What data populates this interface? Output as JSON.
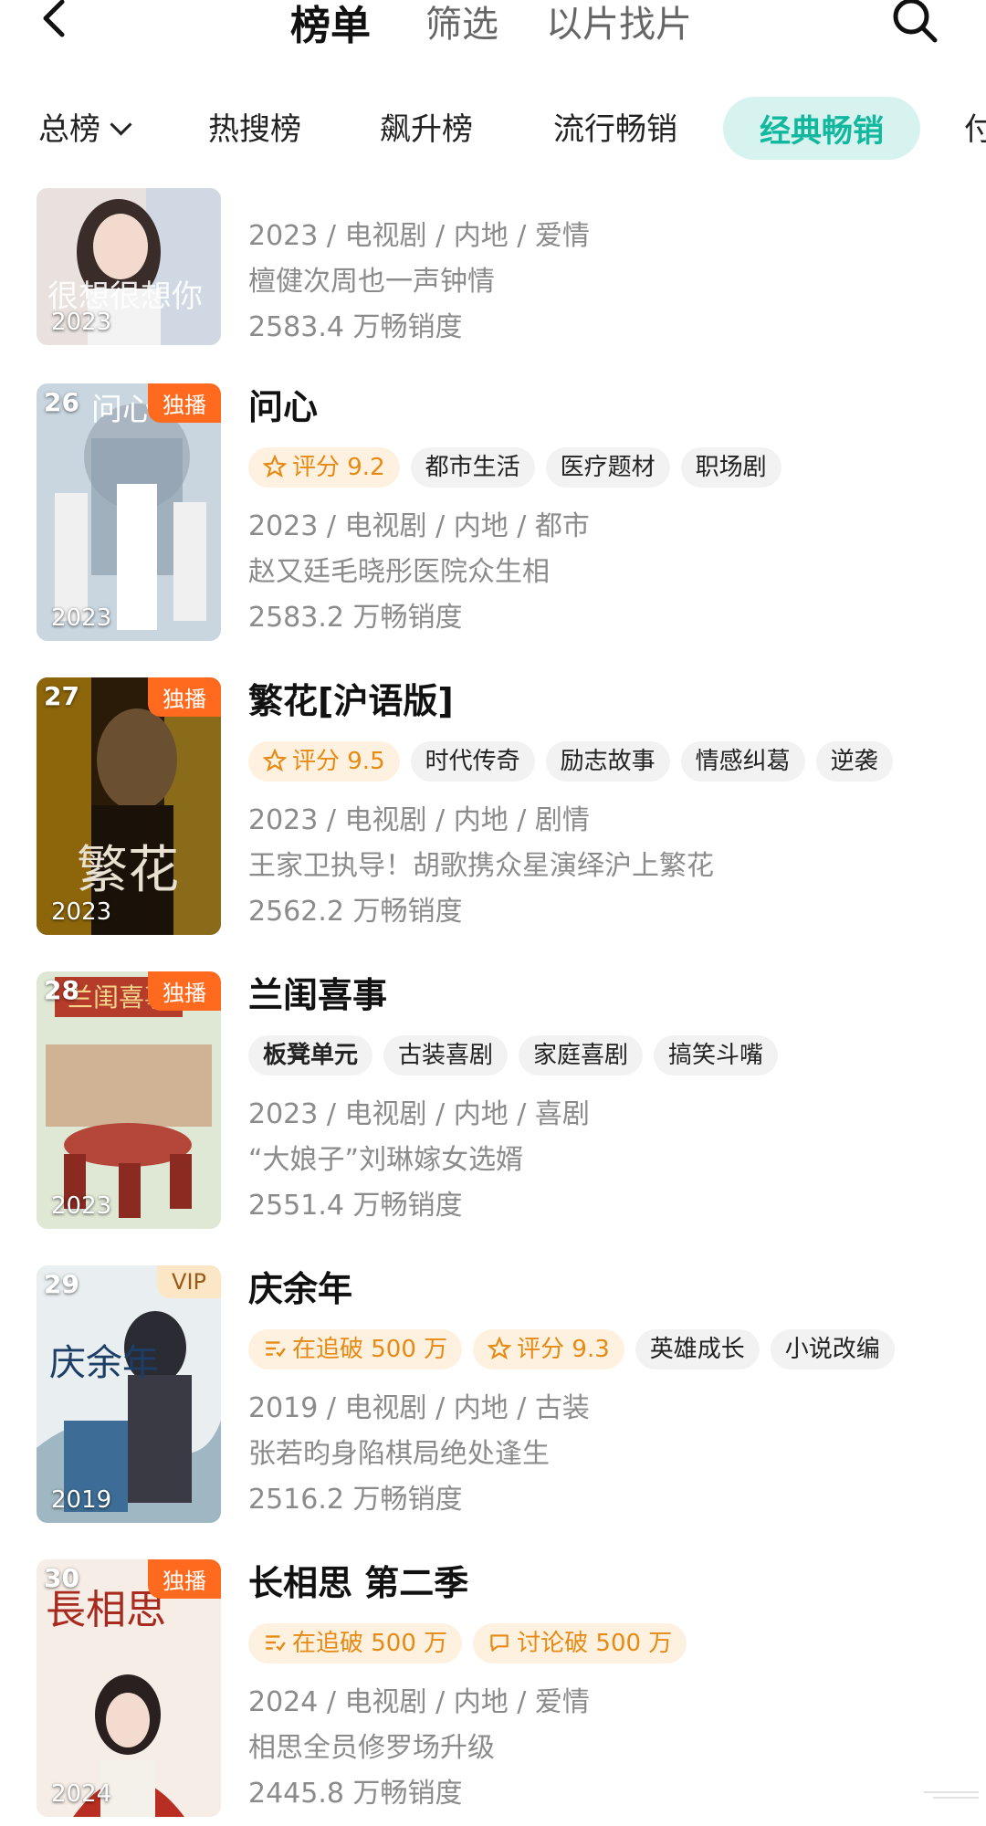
{
  "header": {
    "tabs": [
      "榜单",
      "筛选",
      "以片找片"
    ]
  },
  "subtabs": [
    "总榜",
    "热搜榜",
    "飙升榜",
    "流行畅销",
    "经典畅销",
    "付"
  ],
  "items": [
    {
      "rank": "",
      "title": "",
      "badge": "",
      "year": "2023",
      "poster_text": "很想很想你",
      "tags": [],
      "meta1": "2023 / 电视剧 / 内地 / 爱情",
      "meta2": "檀健次周也一声钟情",
      "meta3": "2583.4 万畅销度"
    },
    {
      "rank": "26",
      "title": "问心",
      "badge": "独播",
      "year": "2023",
      "poster_text": "问心",
      "tags": [
        "评分 9.2",
        "都市生活",
        "医疗题材",
        "职场剧"
      ],
      "meta1": "2023 / 电视剧 / 内地 / 都市",
      "meta2": "赵又廷毛晓彤医院众生相",
      "meta3": "2583.2 万畅销度"
    },
    {
      "rank": "27",
      "title": "繁花[沪语版]",
      "badge": "独播",
      "year": "2023",
      "poster_text": "繁花",
      "tags": [
        "评分 9.5",
        "时代传奇",
        "励志故事",
        "情感纠葛",
        "逆袭"
      ],
      "meta1": "2023 / 电视剧 / 内地 / 剧情",
      "meta2": "王家卫执导！胡歌携众星演绎沪上繁花",
      "meta3": "2562.2 万畅销度"
    },
    {
      "rank": "28",
      "title": "兰闺喜事",
      "badge": "独播",
      "year": "2023",
      "poster_text": "兰闺喜事",
      "tags": [
        "板凳单元",
        "古装喜剧",
        "家庭喜剧",
        "搞笑斗嘴"
      ],
      "meta1": "2023 / 电视剧 / 内地 / 喜剧",
      "meta2": "“大娘子”刘琳嫁女选婿",
      "meta3": "2551.4 万畅销度"
    },
    {
      "rank": "29",
      "title": "庆余年",
      "badge": "VIP",
      "year": "2019",
      "poster_text": "庆余年",
      "tags": [
        "在追破 500 万",
        "评分 9.3",
        "英雄成长",
        "小说改编"
      ],
      "meta1": "2019 / 电视剧 / 内地 / 古装",
      "meta2": "张若昀身陷棋局绝处逢生",
      "meta3": "2516.2 万畅销度"
    },
    {
      "rank": "30",
      "title": "长相思 第二季",
      "badge": "独播",
      "year": "2024",
      "poster_text": "長相思",
      "tags": [
        "在追破 500 万",
        "讨论破 500 万"
      ],
      "meta1": "2024 / 电视剧 / 内地 / 爱情",
      "meta2": "相思全员修罗场升级",
      "meta3": "2445.8 万畅销度"
    }
  ],
  "colors": {
    "accent": "#12b89e",
    "accent_bg": "#d7f3ef",
    "tag_hot": "#e68a14",
    "badge": "#ff6a1f"
  }
}
